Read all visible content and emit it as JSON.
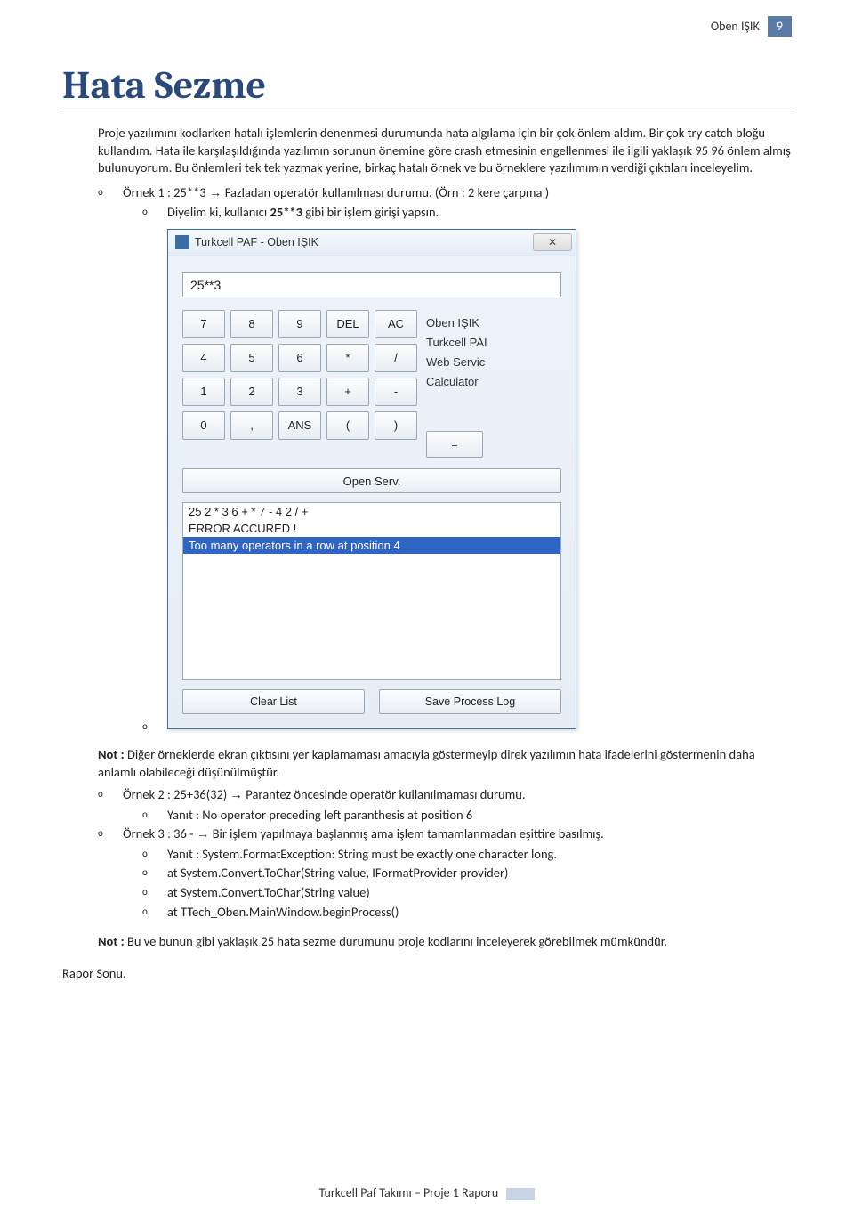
{
  "header": {
    "author": "Oben IŞIK",
    "page_number": "9"
  },
  "title": "Hata Sezme",
  "intro": "Proje yazılımını kodlarken hatalı işlemlerin denenmesi durumunda hata algılama için bir çok önlem aldım. Bir çok try catch bloğu kullandım. Hata ile karşılaşıldığında yazılımın sorunun önemine göre crash etmesinin engellenmesi ile ilgili yaklaşık 95 96 önlem almış bulunuyorum. Bu önlemleri tek tek yazmak yerine, birkaç hatalı örnek ve bu örneklere yazılımımın verdiği çıktıları inceleyelim.",
  "ex1_lead": "Örnek 1 : 25**3 ",
  "ex1_arrow": "→",
  "ex1_tail": " Fazladan operatör kullanılması durumu. (Örn : 2 kere çarpma )",
  "ex1_sub": "Diyelim ki, kullanıcı ",
  "ex1_sub_bold": "25**3",
  "ex1_sub_tail": " gibi bir işlem girişi yapsın.",
  "calc": {
    "window_title": "Turkcell PAF - Oben IŞIK",
    "display_value": "25**3",
    "keypad_rows": [
      [
        "7",
        "8",
        "9",
        "DEL",
        "AC"
      ],
      [
        "4",
        "5",
        "6",
        "*",
        "/"
      ],
      [
        "1",
        "2",
        "3",
        "+",
        "-"
      ],
      [
        "0",
        ",",
        "ANS",
        "(",
        ")"
      ]
    ],
    "side_lines": [
      "Oben IŞIK",
      "",
      "Turkcell PAI",
      "Web Servic",
      "Calculator"
    ],
    "eq_label": "=",
    "open_serv": "Open Serv.",
    "log_rows": [
      "25 2 * 3 6 + * 7 - 4 2 / +",
      "ERROR ACCURED !",
      "Too many operators in a row at position 4"
    ],
    "clear_list": "Clear List",
    "save_log": "Save Process Log",
    "close_x": "✕"
  },
  "note1_bold": "Not : ",
  "note1_text": "Diğer örneklerde ekran çıktısını yer kaplamaması amacıyla göstermeyip direk yazılımın hata ifadelerini göstermenin daha anlamlı olabileceği düşünülmüştür.",
  "ex2_lead": "Örnek 2 : 25+36(32) ",
  "ex2_tail": " Parantez öncesinde operatör kullanılmaması durumu.",
  "ex2_resp": "Yanıt : No operator preceding left paranthesis at position 6",
  "ex3_lead": "Örnek 3 : 36 - ",
  "ex3_tail": " Bir işlem yapılmaya başlanmış ama işlem tamamlanmadan eşittire basılmış.",
  "ex3_lines": [
    "Yanıt : System.FormatException: String must be exactly one character long.",
    "at System.Convert.ToChar(String value, IFormatProvider provider)",
    "at System.Convert.ToChar(String value)",
    "at TTech_Oben.MainWindow.beginProcess()"
  ],
  "note2_bold": "Not : ",
  "note2_text": "Bu ve bunun gibi yaklaşık 25 hata sezme durumunu proje kodlarını inceleyerek görebilmek mümkündür.",
  "report_end": "Rapor Sonu.",
  "footer": "Turkcell Paf Takımı – Proje 1 Raporu",
  "bullet_mark": "o"
}
